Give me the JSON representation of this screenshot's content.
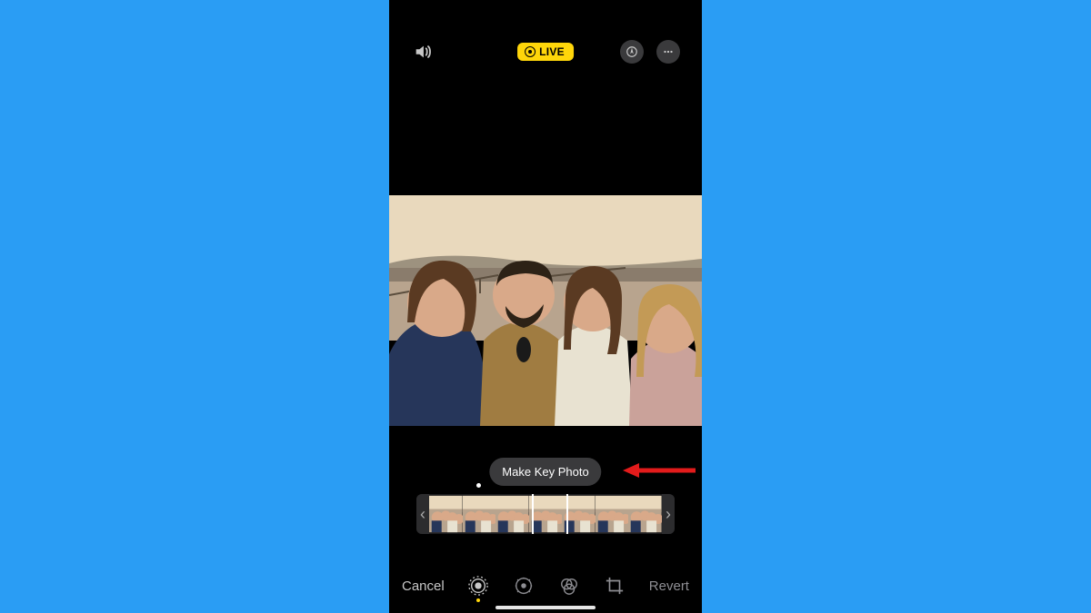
{
  "topbar": {
    "live_label": "LIVE"
  },
  "tooltip": {
    "make_key_photo": "Make Key Photo"
  },
  "toolbar": {
    "cancel_label": "Cancel",
    "revert_label": "Revert"
  },
  "icons": {
    "volume": "volume-icon",
    "markup": "markup-icon",
    "more": "more-icon",
    "live": "live-photo-tool-icon",
    "adjust": "adjust-tool-icon",
    "filters": "filters-tool-icon",
    "crop": "crop-tool-icon"
  },
  "filmstrip": {
    "handle_left": "‹",
    "handle_right": "›",
    "frame_count": 7
  },
  "colors": {
    "accent_yellow": "#ffd60a",
    "pill_bg": "#3a3a3c",
    "background": "#2a9df4",
    "annotation_red": "#e21b1b"
  }
}
